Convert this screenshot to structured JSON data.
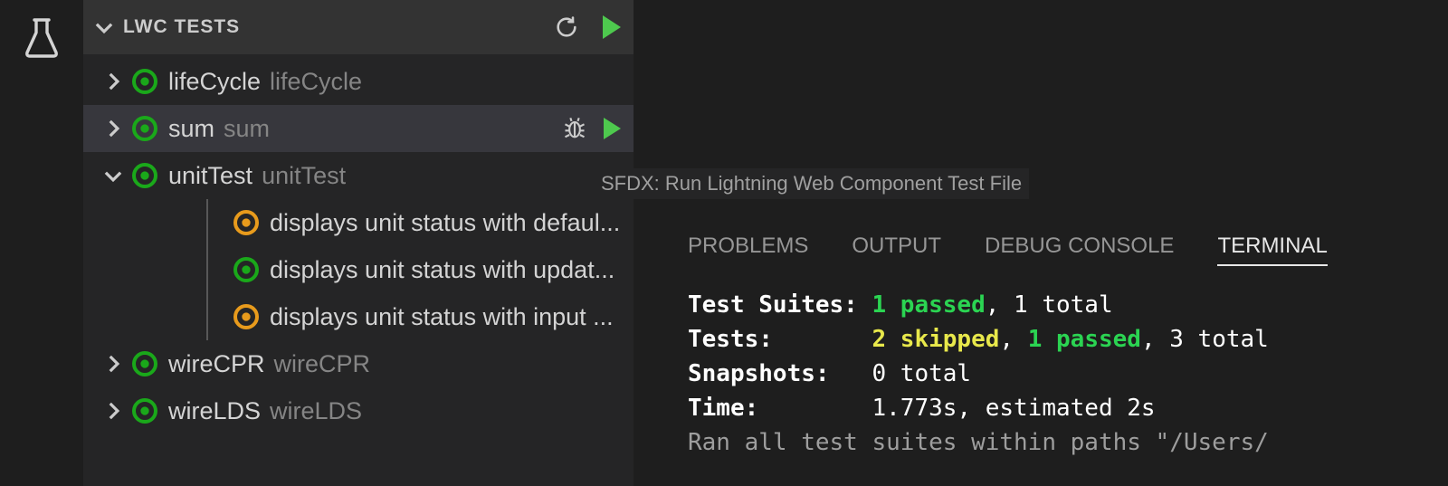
{
  "sidebar": {
    "section_title": "LWC TESTS",
    "items": [
      {
        "label": "lifeCycle",
        "sub": "lifeCycle",
        "expanded": false,
        "status": "pass",
        "selected": false
      },
      {
        "label": "sum",
        "sub": "sum",
        "expanded": false,
        "status": "pass",
        "selected": true
      },
      {
        "label": "unitTest",
        "sub": "unitTest",
        "expanded": true,
        "status": "pass",
        "selected": false,
        "children": [
          {
            "text": "displays unit status with defaul...",
            "status": "skip"
          },
          {
            "text": "displays unit status with updat...",
            "status": "pass"
          },
          {
            "text": "displays unit status with input ...",
            "status": "skip"
          }
        ]
      },
      {
        "label": "wireCPR",
        "sub": "wireCPR",
        "expanded": false,
        "status": "pass",
        "selected": false
      },
      {
        "label": "wireLDS",
        "sub": "wireLDS",
        "expanded": false,
        "status": "pass",
        "selected": false
      }
    ]
  },
  "tooltip": "SFDX: Run Lightning Web Component Test File",
  "panel": {
    "tabs": [
      "PROBLEMS",
      "OUTPUT",
      "DEBUG CONSOLE",
      "TERMINAL"
    ],
    "active_tab": 3
  },
  "terminal": {
    "line1_label": "Test Suites: ",
    "line1_pass": "1 passed",
    "line1_rest": ", 1 total",
    "line2_label": "Tests:       ",
    "line2_skip": "2 skipped",
    "line2_sep": ", ",
    "line2_pass": "1 passed",
    "line2_rest": ", 3 total",
    "line3_label": "Snapshots:   ",
    "line3_rest": "0 total",
    "line4_label": "Time:        ",
    "line4_rest": "1.773s, estimated 2s",
    "line5": "Ran all test suites within paths \"/Users/"
  }
}
